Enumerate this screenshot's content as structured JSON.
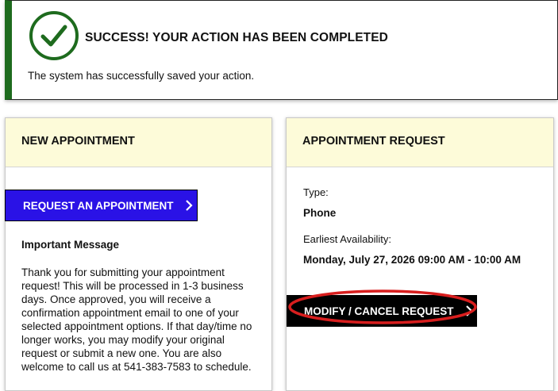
{
  "alert": {
    "title": "SUCCESS! YOUR ACTION HAS BEEN COMPLETED",
    "message": "The system has successfully saved your action.",
    "icon": "check-circle-icon",
    "accent_color": "#1e6b1e"
  },
  "new_appointment": {
    "header": "NEW APPOINTMENT",
    "request_button": "REQUEST AN APPOINTMENT",
    "important_title": "Important Message",
    "important_body": "Thank you for submitting your appointment request! This will be processed in 1-3 business days. Once approved, you will receive a confirmation appointment email to one of your selected appointment options. If that day/time no longer works, you may modify your original request or submit a new one. You are also welcome to call us at 541-383-7583 to schedule.",
    "button_color": "#2a12e6"
  },
  "appointment_request": {
    "header": "APPOINTMENT REQUEST",
    "type_label": "Type:",
    "type_value": "Phone",
    "availability_label": "Earliest Availability:",
    "availability_value": "Monday, July 27, 2026 09:00 AM - 10:00 AM",
    "modify_button": "MODIFY / CANCEL REQUEST",
    "annotation_color": "#d81e1e"
  }
}
